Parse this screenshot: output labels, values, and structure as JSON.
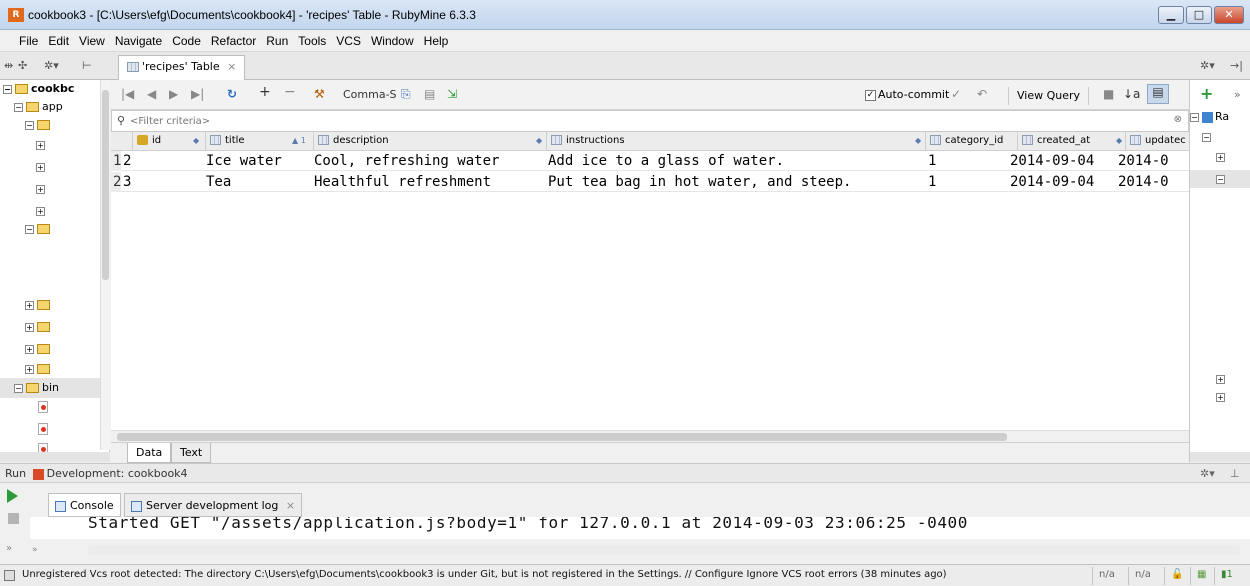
{
  "window": {
    "title": "cookbook3 - [C:\\Users\\efg\\Documents\\cookbook4] - 'recipes' Table - RubyMine 6.3.3",
    "logo_text": "R",
    "minimize_icon": "minimize-icon",
    "maximize_icon": "maximize-icon",
    "close_icon": "close-icon"
  },
  "menu": [
    "File",
    "Edit",
    "View",
    "Navigate",
    "Code",
    "Refactor",
    "Run",
    "Tools",
    "VCS",
    "Window",
    "Help"
  ],
  "editor_tab": {
    "label": "'recipes' Table",
    "close": "×"
  },
  "project_tree": {
    "root_label": "cookbc",
    "app_label": "app",
    "bin_label": "bin"
  },
  "table_toolbar": {
    "first_icon": "|◀",
    "prev_icon": "◀",
    "next_icon": "▶",
    "last_icon": "▶|",
    "refresh_icon": "↻",
    "add_icon": "+",
    "remove_icon": "−",
    "separator_label": "Comma-S",
    "autocommit_label": "Auto-commit",
    "autocommit_checked": "✓",
    "view_query_label": "View Query"
  },
  "filter": {
    "placeholder": "<Filter criteria>",
    "value": ""
  },
  "grid": {
    "columns": [
      {
        "label": "id",
        "sort": "◆"
      },
      {
        "label": "title",
        "sort": "▲ 1"
      },
      {
        "label": "description",
        "sort": "◆"
      },
      {
        "label": "instructions",
        "sort": "◆"
      },
      {
        "label": "category_id",
        "sort": ""
      },
      {
        "label": "created_at",
        "sort": "◆"
      },
      {
        "label": "updatec",
        "sort": ""
      }
    ],
    "rows": [
      {
        "num": "1",
        "id": "2",
        "title": "Ice water",
        "description": "Cool, refreshing water",
        "instructions": "Add ice to a glass of water.",
        "category_id": "1",
        "created_at": "2014-09-04",
        "updated": "2014-0"
      },
      {
        "num": "2",
        "id": "3",
        "title": "Tea",
        "description": "Healthful refreshment",
        "instructions": "Put tea bag in hot water, and steep.",
        "category_id": "1",
        "created_at": "2014-09-04",
        "updated": "2014-0"
      }
    ]
  },
  "data_tabs": [
    "Data",
    "Text"
  ],
  "right_panel": {
    "plus": "+",
    "chevron": "»",
    "node_label": "Ra"
  },
  "run_panel": {
    "label": "Run",
    "config": "Development: cookbook4",
    "tabs": [
      {
        "label": "Console"
      },
      {
        "label": "Server development log",
        "close": "×"
      }
    ],
    "console_line": "Started GET \"/assets/application.js?body=1\" for 127.0.0.1 at 2014-09-03 23:06:25 -0400"
  },
  "status": {
    "message": "Unregistered Vcs root detected: The directory C:\\Users\\efg\\Documents\\cookbook3 is under Git, but is not registered in the Settings. // Configure  Ignore VCS root errors (38 minutes ago)",
    "field1": "n/a",
    "field2": "n/a"
  }
}
